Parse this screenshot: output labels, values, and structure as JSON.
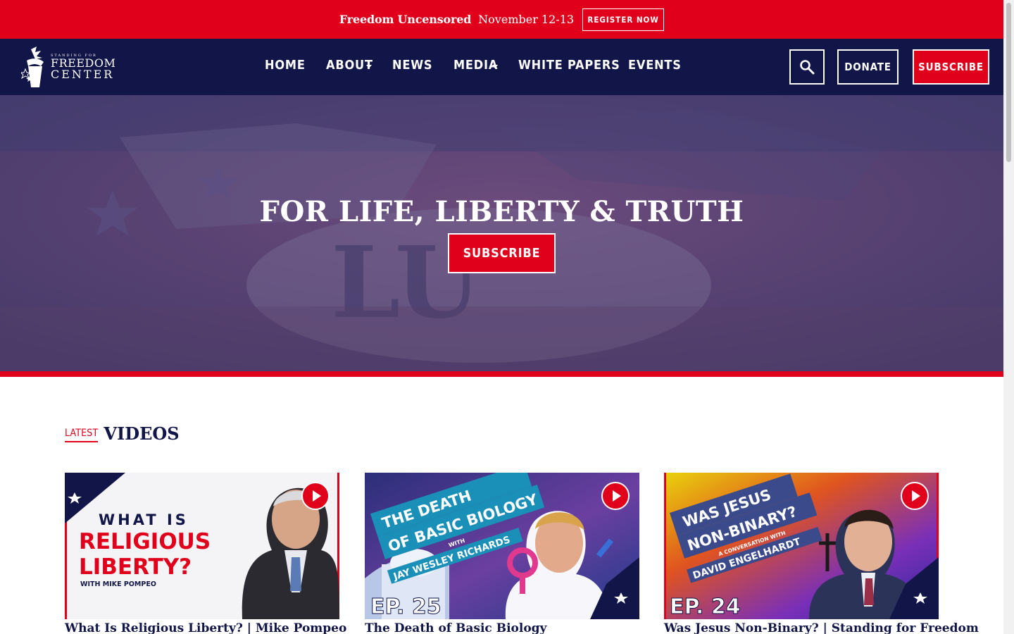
{
  "announcement": {
    "event_name": "Freedom Uncensored",
    "event_date": "November 12-13",
    "register_label": "REGISTER NOW"
  },
  "logo": {
    "line1": "STANDING FOR",
    "line2": "FREEDOM",
    "line3": "CENTER"
  },
  "nav": {
    "items": [
      {
        "label": "HOME",
        "has_dropdown": false
      },
      {
        "label": "ABOUT",
        "has_dropdown": true
      },
      {
        "label": "NEWS",
        "has_dropdown": false
      },
      {
        "label": "MEDIA",
        "has_dropdown": true
      },
      {
        "label": "WHITE PAPERS",
        "has_dropdown": false
      },
      {
        "label": "EVENTS",
        "has_dropdown": false
      }
    ],
    "donate_label": "DONATE",
    "subscribe_label": "SUBSCRIBE"
  },
  "hero": {
    "title": "FOR LIFE, LIBERTY & TRUTH",
    "button_label": "SUBSCRIBE"
  },
  "videos": {
    "kicker": "LATEST",
    "title": "VIDEOS",
    "cards": [
      {
        "title": "What Is Religious Liberty? | Mike Pompeo",
        "thumb": {
          "l1": "WHAT IS",
          "l2": "RELIGIOUS",
          "l3": "LIBERTY?",
          "l4": "WITH MIKE POMPEO"
        }
      },
      {
        "title": "The Death of Basic Biology",
        "thumb": {
          "l1": "THE DEATH",
          "l2": "OF BASIC BIOLOGY",
          "l3": "WITH",
          "l4": "JAY WESLEY RICHARDS",
          "ep": "EP. 25"
        }
      },
      {
        "title": "Was Jesus Non-Binary? | Standing for Freedom",
        "thumb": {
          "l1": "WAS JESUS",
          "l2": "NON-BINARY?",
          "l3": "A CONVERSATION WITH",
          "l4": "DAVID ENGELHARDT",
          "ep": "EP. 24"
        }
      }
    ]
  },
  "colors": {
    "brand_red": "#e0001b",
    "brand_navy": "#111547"
  }
}
